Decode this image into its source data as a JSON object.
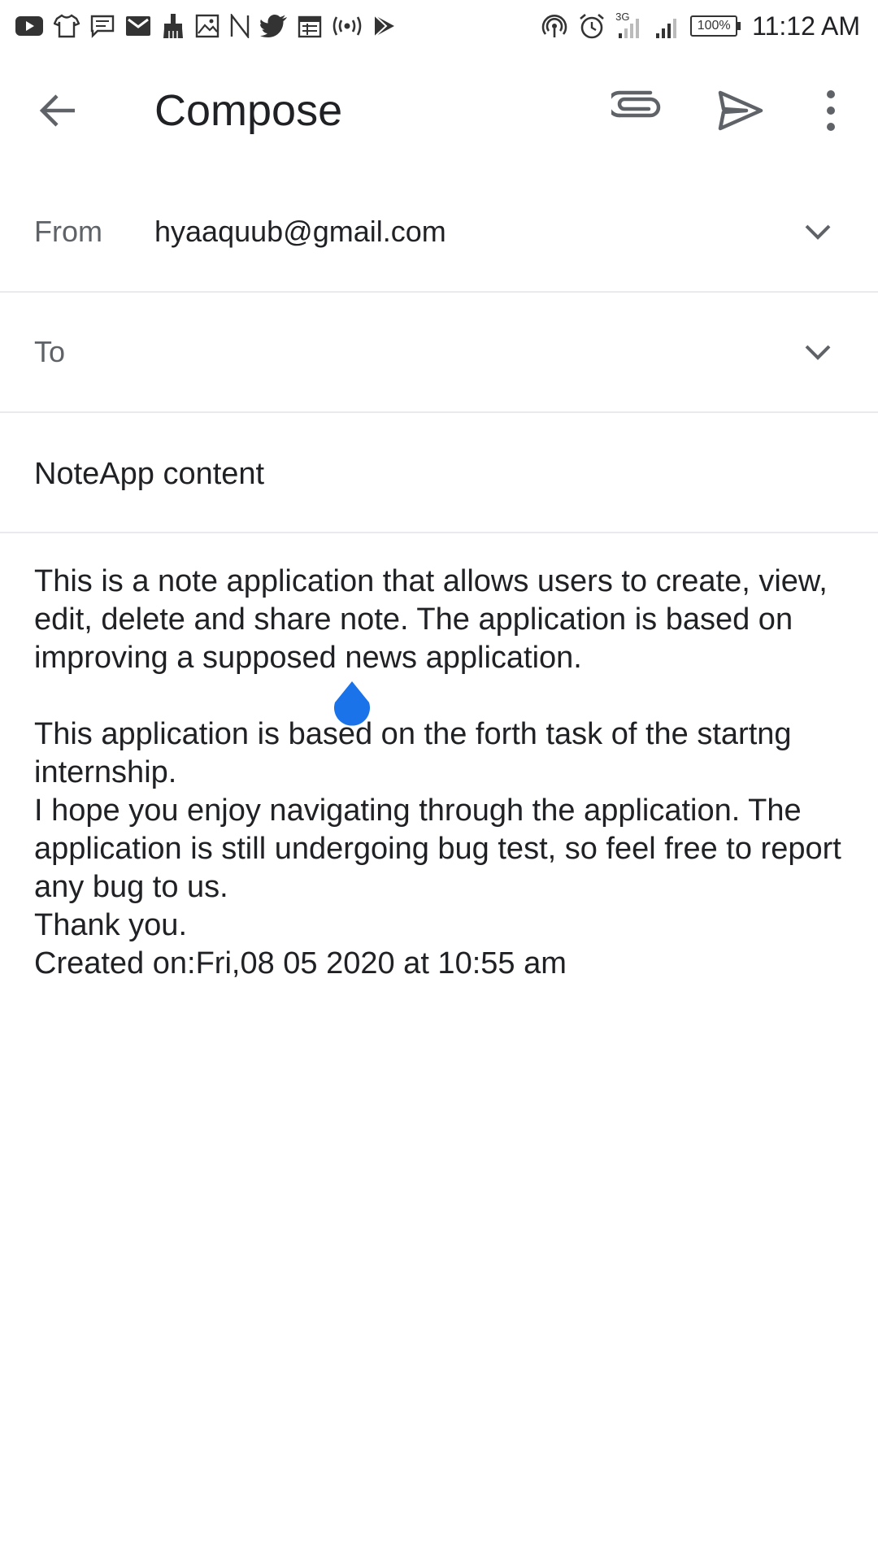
{
  "status_bar": {
    "time": "11:12 AM",
    "battery": "100%",
    "network": "3G",
    "left_icons": [
      "youtube-icon",
      "tshirt-icon",
      "message-icon",
      "gmail-icon",
      "broom-icon",
      "image-icon",
      "n-icon",
      "twitter-icon",
      "calendar-icon",
      "broadcast-icon",
      "play-store-icon"
    ],
    "right_icons": [
      "hotspot-icon",
      "alarm-icon",
      "signal-icon",
      "signal-icon",
      "battery-icon"
    ]
  },
  "app_bar": {
    "title": "Compose",
    "back_icon": "arrow-back-icon",
    "actions": [
      "attach-icon",
      "send-icon",
      "more-vert-icon"
    ]
  },
  "from_field": {
    "label": "From",
    "value": "hyaaquub@gmail.com"
  },
  "to_field": {
    "label": "To",
    "value": ""
  },
  "subject": {
    "value": "NoteApp content"
  },
  "body": {
    "text": "This is a note application that allows users to create, view, edit, delete and share note. The application is based on improving a supposed news application.\n\nThis application is based on the forth task of the startng internship.\nI hope you enjoy navigating through the application. The application is still undergoing bug test, so feel free to report any bug to us.\nThank you.\nCreated on:Fri,08 05 2020 at 10:55 am"
  },
  "colors": {
    "accent": "#1a73e8",
    "icon": "#5f6368",
    "text": "#202124",
    "divider": "#e8eaed"
  }
}
